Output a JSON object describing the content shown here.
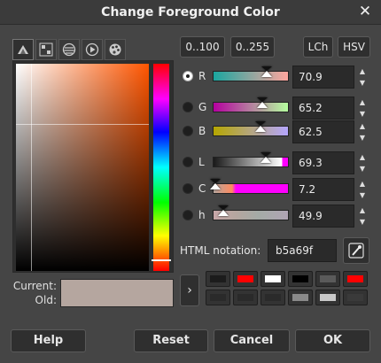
{
  "window": {
    "title": "Change Foreground Color",
    "close_glyph": "✕"
  },
  "selector_tabs": [
    {
      "name": "gimp-selector-icon",
      "active": true
    },
    {
      "name": "cmyk-selector-icon",
      "active": false
    },
    {
      "name": "watercolor-selector-icon",
      "active": false
    },
    {
      "name": "wheel-selector-icon",
      "active": false
    },
    {
      "name": "palette-selector-icon",
      "active": false
    }
  ],
  "range_buttons": {
    "range_100": "0..100",
    "range_255": "0..255",
    "lch": "LCh",
    "hsv": "HSV"
  },
  "channels": [
    {
      "label": "R",
      "value": "70.9",
      "fraction": 0.709,
      "selected": true,
      "gradient": "linear-gradient(to right, #1aa69f, #ffa69f)"
    },
    {
      "label": "G",
      "value": "65.2",
      "fraction": 0.652,
      "selected": false,
      "gradient": "linear-gradient(to right, #b5009f, #b5ff9f)"
    },
    {
      "label": "B",
      "value": "62.5",
      "fraction": 0.625,
      "selected": false,
      "gradient": "linear-gradient(to right, #b5a600, #b5a6ff)"
    },
    {
      "label": "L",
      "value": "69.3",
      "fraction": 0.693,
      "selected": false,
      "gradient": "linear-gradient(to right, #1a1a1a, #ffffff 92%, #ff00ff 92%)"
    },
    {
      "label": "C",
      "value": "7.2",
      "fraction": 0.036,
      "selected": false,
      "gradient": "linear-gradient(to right, #b5a69f, #ff8a5f 25%, #ff00ff 30%, #ff00ff)"
    },
    {
      "label": "h",
      "value": "49.9",
      "fraction": 0.139,
      "selected": false,
      "gradient": "linear-gradient(to right, #c9a7a9, #b5a69f 30%, #a4aba6 60%, #b0a4b4)"
    }
  ],
  "spin_up_glyph": "▲",
  "spin_down_glyph": "▼",
  "html_notation": {
    "label": "HTML notation:",
    "value": "b5a69f"
  },
  "eyedropper": {
    "icon": "eyedropper-icon"
  },
  "current_label": "Current:",
  "old_label": "Old:",
  "current_color": "#b5a69f",
  "arrow_glyph": "›",
  "history": [
    "#1c1c1c",
    "#ff0000",
    "#ffffff",
    "#000000",
    "#5a5a5a",
    "#ff0000",
    "#2a2a2a",
    "#2a2a2a",
    "#2a2a2a",
    "#8a8a8a",
    "#c8c8c8",
    "#3a3a3a"
  ],
  "footer": {
    "help": "Help",
    "reset": "Reset",
    "cancel": "Cancel",
    "ok": "OK"
  }
}
